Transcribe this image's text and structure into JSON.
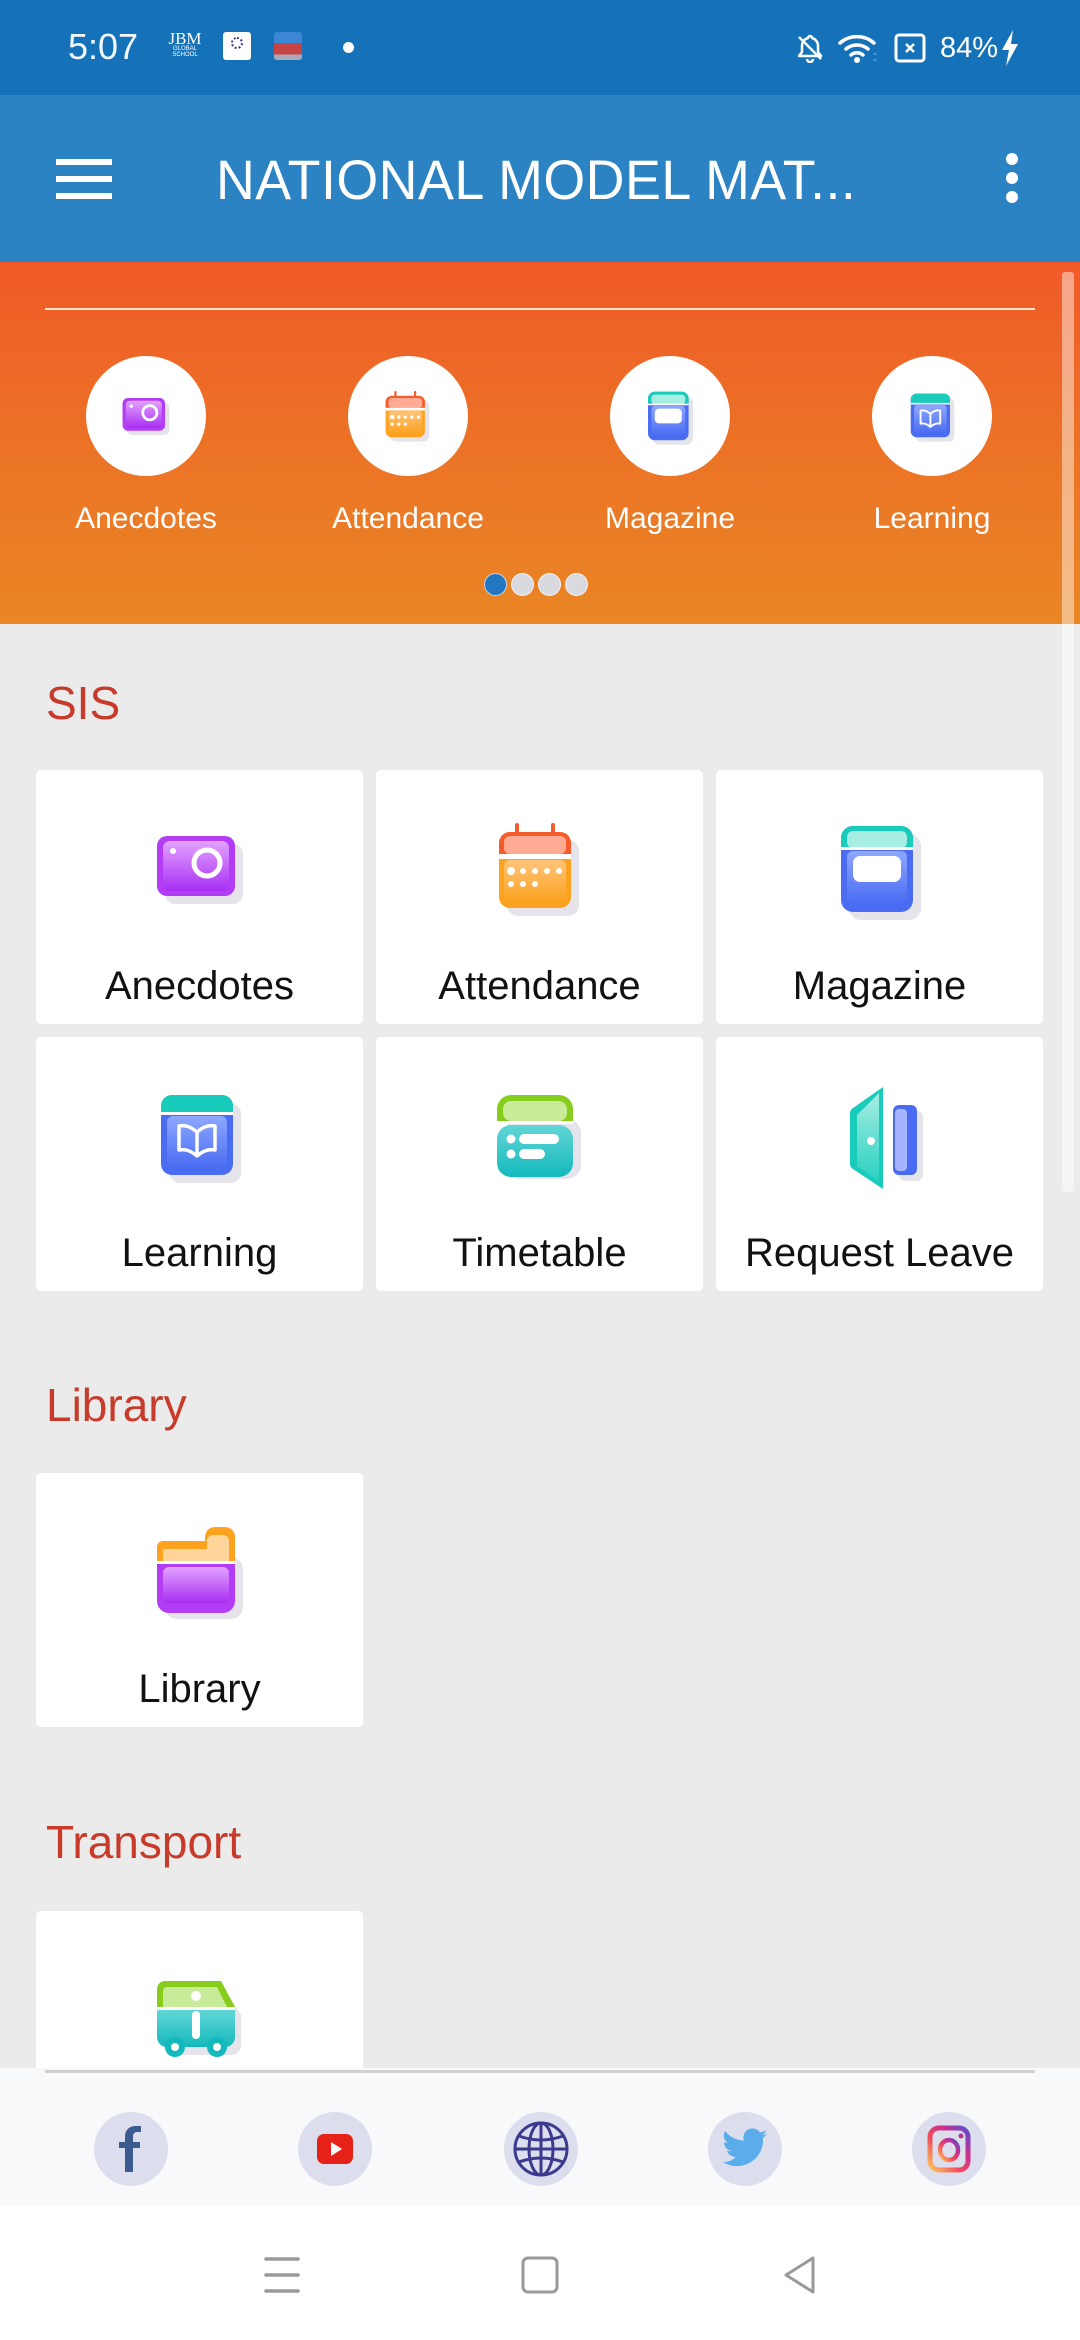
{
  "status_bar": {
    "time": "5:07",
    "notifications": [
      "jbm-global-school-app",
      "ryan-school-app",
      "school-building-app",
      "more-dot"
    ],
    "jbm_text": "JBM",
    "jbm_sub": "GLOBAL SCHOOL",
    "battery_percent": "84%",
    "icons": [
      "bell-off-icon",
      "wifi-icon",
      "sim-off-icon",
      "charging-icon"
    ]
  },
  "app_bar": {
    "title": "NATIONAL MODEL MAT...",
    "menu_icon": "hamburger-icon",
    "overflow_icon": "more-vert-icon"
  },
  "banner": {
    "items": [
      {
        "label": "Anecdotes",
        "icon": "camera-icon"
      },
      {
        "label": "Attendance",
        "icon": "calendar-icon"
      },
      {
        "label": "Magazine",
        "icon": "magazine-icon"
      },
      {
        "label": "Learning",
        "icon": "book-icon"
      }
    ],
    "page_count": 4,
    "active_page": 1
  },
  "sections": {
    "sis": {
      "title": "SIS",
      "items": [
        {
          "label": "Anecdotes",
          "icon": "camera-icon"
        },
        {
          "label": "Attendance",
          "icon": "calendar-icon"
        },
        {
          "label": "Magazine",
          "icon": "magazine-icon"
        },
        {
          "label": "Learning",
          "icon": "book-icon"
        },
        {
          "label": "Timetable",
          "icon": "timetable-icon"
        },
        {
          "label": "Request Leave",
          "icon": "door-icon"
        }
      ]
    },
    "library": {
      "title": "Library",
      "items": [
        {
          "label": "Library",
          "icon": "folder-icon"
        }
      ]
    },
    "transport": {
      "title": "Transport",
      "items": [
        {
          "label": "",
          "icon": "bus-info-icon"
        }
      ]
    }
  },
  "social": [
    "facebook-icon",
    "youtube-icon",
    "globe-icon",
    "twitter-icon",
    "instagram-icon"
  ],
  "nav": [
    "recents-icon",
    "home-icon",
    "back-icon"
  ],
  "colors": {
    "status_bar": "#1572b9",
    "app_bar": "#2b83c4",
    "banner_top": "#f05a28",
    "banner_bottom": "#ea8625",
    "section_title": "#c83a2a",
    "background": "#ebebeb"
  }
}
